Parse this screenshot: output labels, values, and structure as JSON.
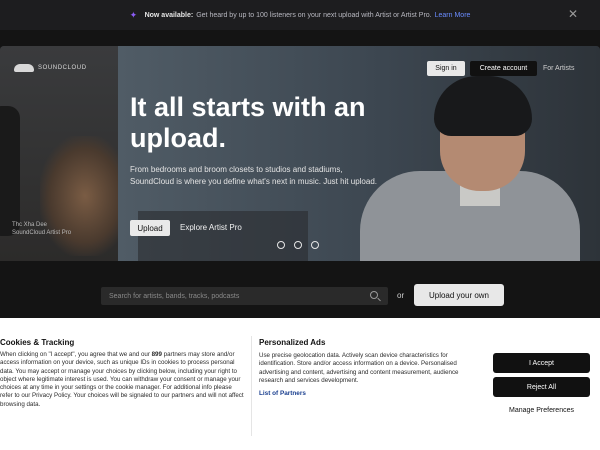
{
  "announcement": {
    "strong": "Now available:",
    "text": "Get heard by up to 100 listeners on your next upload with Artist or Artist Pro.",
    "link": "Learn More"
  },
  "header": {
    "logo_text": "SOUNDCLOUD",
    "sign_in": "Sign in",
    "create_account": "Create account",
    "for_artists": "For Artists"
  },
  "hero": {
    "headline": "It all starts with an upload.",
    "subtext": "From bedrooms and broom closets to studios and stadiums, SoundCloud is where you define what's next in music. Just hit upload.",
    "upload_button": "Upload",
    "explore_link": "Explore Artist Pro",
    "side_caption_line1": "Thc Xha Dee",
    "side_caption_line2": "SoundCloud Artist Pro"
  },
  "search": {
    "placeholder": "Search for artists, bands, tracks, podcasts",
    "or_text": "or",
    "upload_own": "Upload your own"
  },
  "cookie": {
    "title": "Cookies & Tracking",
    "body_pre": "When clicking on \"I accept\", you agree that we and our ",
    "partners_count": "899",
    "body_post": " partners may store and/or access information on your device, such as unique IDs in cookies to process personal data. You may accept or manage your choices by clicking below, including your right to object where legitimate interest is used. You can withdraw your consent or manage your choices at any time in your settings or the cookie manager. For additional info please refer to our Privacy Policy. Your choices will be signaled to our partners and will not affect browsing data.",
    "ads_title": "Personalized Ads",
    "ads_body": "Use precise geolocation data. Actively scan device characteristics for identification. Store and/or access information on a device. Personalised advertising and content, advertising and content measurement, audience research and services development.",
    "list_link": "List of Partners",
    "accept": "I Accept",
    "reject": "Reject All",
    "manage": "Manage Preferences"
  }
}
